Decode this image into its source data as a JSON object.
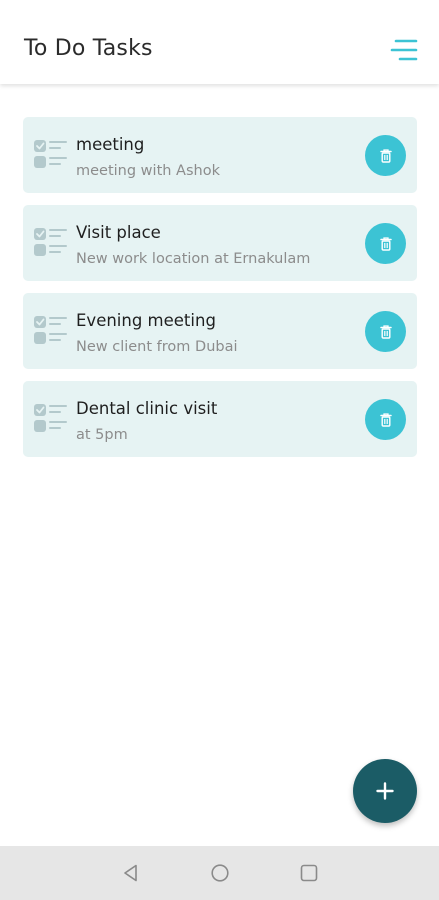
{
  "app_bar": {
    "title": "To Do Tasks",
    "menu_icon": "menu-lines-icon"
  },
  "tasks": [
    {
      "title": "meeting",
      "description": "meeting with Ashok"
    },
    {
      "title": "Visit place",
      "description": "New work location at Ernakulam"
    },
    {
      "title": "Evening meeting",
      "description": "New client from Dubai"
    },
    {
      "title": "Dental clinic visit",
      "description": "at 5pm"
    }
  ],
  "task_icon": "checklist-icon",
  "delete_icon": "trash-icon",
  "fab_icon": "plus-icon",
  "nav_bar": {
    "buttons": [
      "back-triangle-icon",
      "home-circle-icon",
      "recents-square-icon"
    ]
  },
  "colors": {
    "accent": "#3cc3d4",
    "card_background": "#e6f3f3",
    "fab": "#1b5c66",
    "nav_bar": "#e6e6e6"
  }
}
